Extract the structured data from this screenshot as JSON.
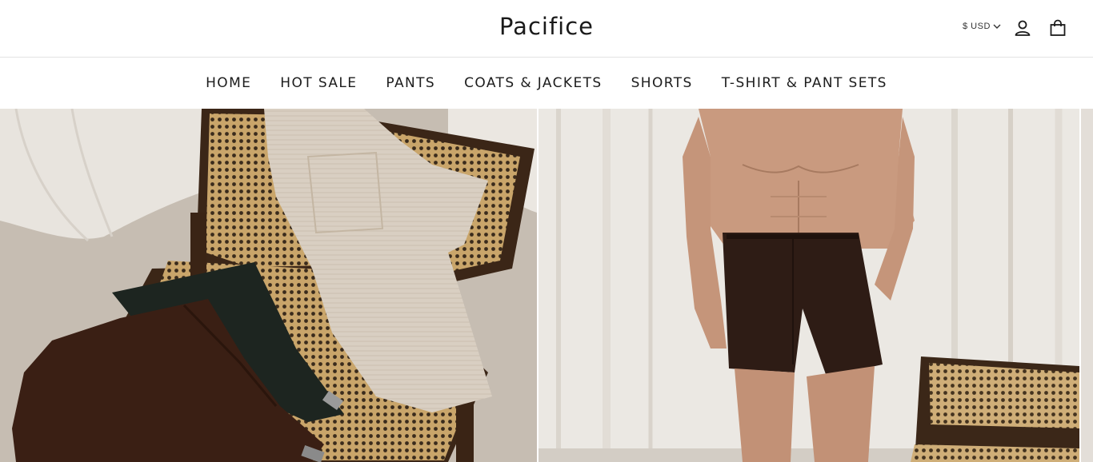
{
  "header": {
    "logo": "Pacifice",
    "currency": "$ USD",
    "icons": {
      "account": "user-icon",
      "cart": "shopping-bag-icon",
      "dropdown": "chevron-down-icon"
    }
  },
  "nav": {
    "items": [
      {
        "label": "HOME"
      },
      {
        "label": "HOT SALE"
      },
      {
        "label": "PANTS"
      },
      {
        "label": "COATS & JACKETS"
      },
      {
        "label": "SHORTS"
      },
      {
        "label": "T-SHIRT & PANT SETS"
      }
    ]
  },
  "colors": {
    "text": "#1c1c1c",
    "divider": "#e3e3e3",
    "background": "#ffffff"
  }
}
